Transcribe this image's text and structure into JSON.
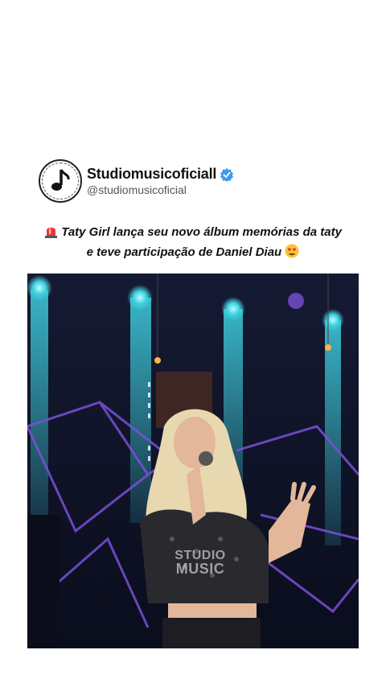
{
  "post": {
    "display_name": "Studiomusicoficiall",
    "handle": "@studiomusicoficial",
    "verified": true,
    "avatar_icon": "music-note-icon",
    "caption": {
      "leading_emoji": "siren-icon",
      "line1": "Taty Girl lança seu novo álbum memórias da taty",
      "line2": "e teve participação de Daniel Diau",
      "trailing_emoji": "smiling-face-with-heart-eyes-icon"
    }
  },
  "video": {
    "watermark_line1": "STUDIO",
    "watermark_line2": "MUSIC"
  },
  "colors": {
    "verified_badge": "#3b9cf0",
    "stage_light": "#3fd0e0",
    "stage_background": "#0d1226"
  }
}
